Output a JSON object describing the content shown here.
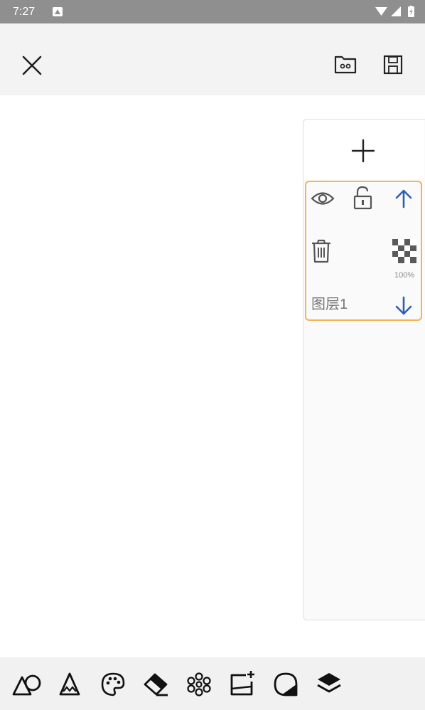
{
  "status_bar": {
    "time": "7:27"
  },
  "top_bar": {
    "close_icon": "close-icon",
    "open_icon": "folder-icon",
    "save_icon": "save-icon"
  },
  "layers_panel": {
    "add_icon": "plus-icon",
    "layers": [
      {
        "name": "图层1",
        "opacity": "100%",
        "selected": true
      }
    ],
    "accent_color": "#f0b650",
    "arrow_color": "#2f5fb0"
  },
  "bottom_toolbar": {
    "tools": [
      "shapes-icon",
      "pencil-icon",
      "palette-icon",
      "eraser-icon",
      "flower-brush-icon",
      "add-image-icon",
      "fill-icon",
      "layers-icon"
    ]
  }
}
